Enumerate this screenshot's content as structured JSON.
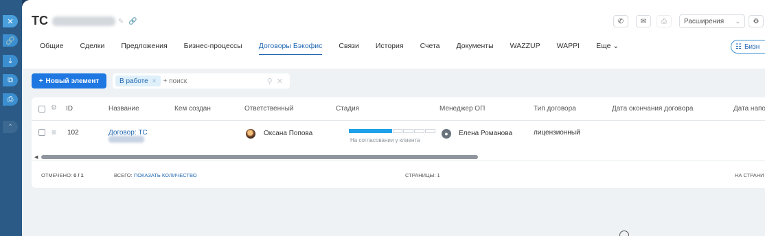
{
  "rail": {
    "close_icon": "✕",
    "link_icon": "🔗",
    "download_icon": "⤓",
    "open_icon": "⧉",
    "print_icon": "⎙",
    "collapse_icon": "⌃"
  },
  "header": {
    "title": "ТС",
    "toolbar": {
      "phone_icon": "✆",
      "mail_icon": "✉",
      "doc_icon": "⎙",
      "extensions_label": "Расширения",
      "extensions_chevron": "⌄",
      "settings_icon": "⚙"
    }
  },
  "tabs": [
    {
      "label": "Общие"
    },
    {
      "label": "Сделки"
    },
    {
      "label": "Предложения"
    },
    {
      "label": "Бизнес-процессы"
    },
    {
      "label": "Договоры Бэкофис",
      "active": true
    },
    {
      "label": "Связи"
    },
    {
      "label": "История"
    },
    {
      "label": "Счета"
    },
    {
      "label": "Документы"
    },
    {
      "label": "WAZZUP"
    },
    {
      "label": "WAPPI"
    },
    {
      "label": "Еще ⌄"
    }
  ],
  "biz_button": {
    "icon": "☷",
    "label": "Бизн"
  },
  "actions": {
    "new_button_plus": "+",
    "new_button_label": "Новый элемент"
  },
  "filter": {
    "chip_label": "В работе",
    "chip_remove": "×",
    "search_placeholder": "+ поиск",
    "search_icon": "⚲",
    "clear_icon": "✕"
  },
  "grid": {
    "settings_icon": "⚙",
    "columns": [
      "ID",
      "Название",
      "Кем создан",
      "Ответственный",
      "Стадия",
      "Менеджер ОП",
      "Тип договора",
      "Дата окончания договора",
      "Дата напо"
    ],
    "rows": [
      {
        "drag_icon": "≡",
        "id": "102",
        "name": "Договор: ТС",
        "created_by": "",
        "responsible": "Оксана Попова",
        "stage_progress": 0.5,
        "stage_segments": 8,
        "stage_label": "На согласовании у клиента",
        "manager": "Елена Романова",
        "contract_type": "лицензионный"
      }
    ],
    "scroll_position": 0.6
  },
  "footer": {
    "marked_label": "ОТМЕЧЕНО:",
    "marked_value": "0 / 1",
    "total_label": "ВСЕГО:",
    "total_link": "ПОКАЗАТЬ КОЛИЧЕСТВО",
    "pages_label": "СТРАНИЦЫ:",
    "pages_value": "1",
    "per_page_label": "НА СТРАНИ"
  }
}
